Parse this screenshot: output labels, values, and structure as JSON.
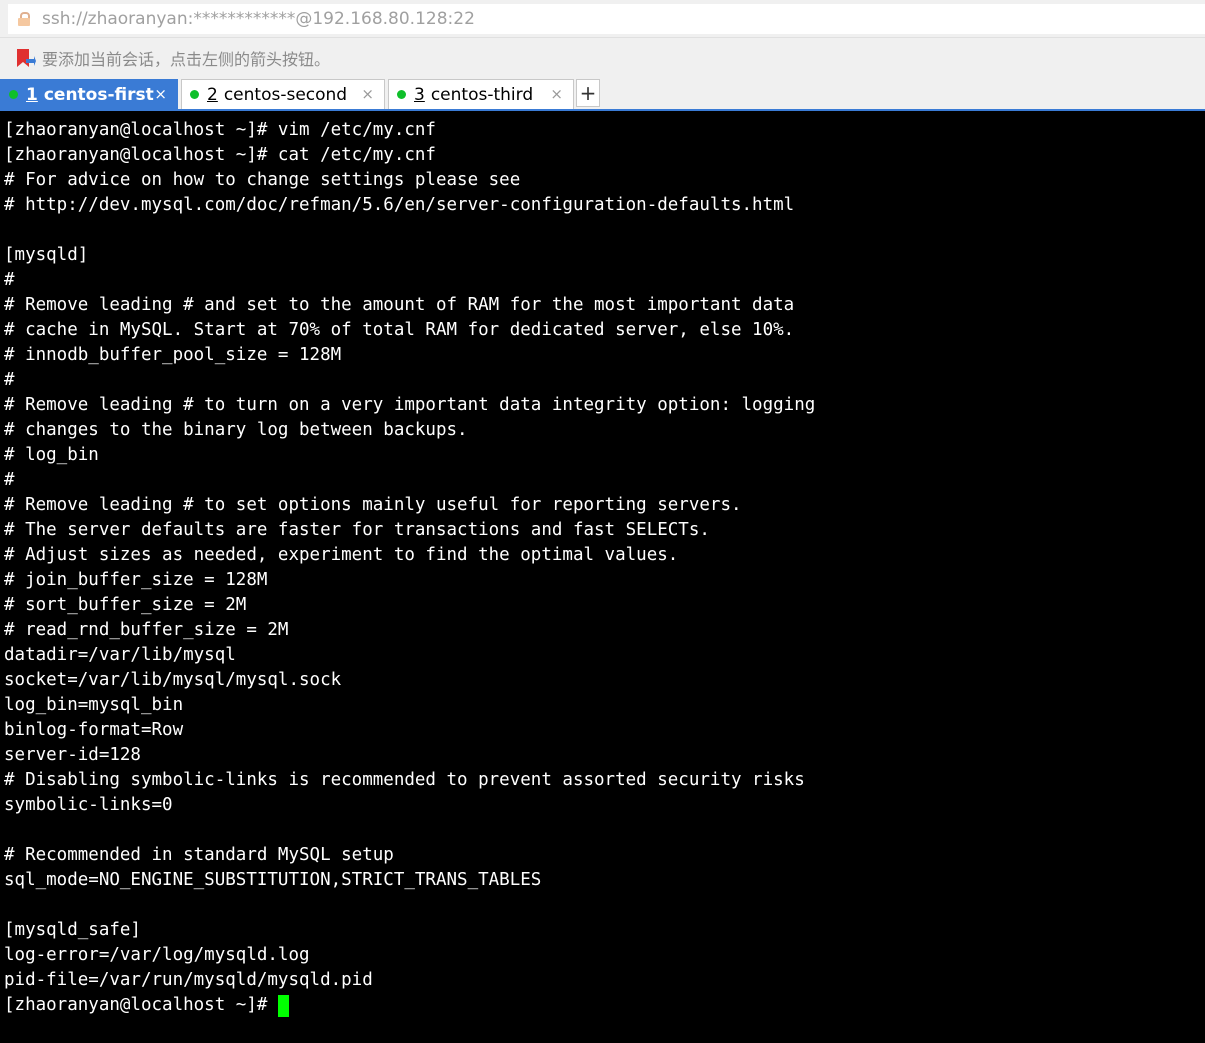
{
  "address_bar": {
    "url": "ssh://zhaoranyan:************@192.168.80.128:22",
    "icon": "lock-icon"
  },
  "hint_bar": {
    "text": "要添加当前会话，点击左侧的箭头按钮。",
    "icon": "bookmark-arrow-icon"
  },
  "tabs": [
    {
      "number": "1",
      "label": "centos-first",
      "active": true,
      "status_color": "#0fbf2a"
    },
    {
      "number": "2",
      "label": "centos-second",
      "active": false,
      "status_color": "#0fbf2a"
    },
    {
      "number": "3",
      "label": "centos-third",
      "active": false,
      "status_color": "#0fbf2a"
    }
  ],
  "tab_close_glyph": "×",
  "tab_add_glyph": "+",
  "terminal": {
    "lines": [
      "[zhaoranyan@localhost ~]# vim /etc/my.cnf",
      "[zhaoranyan@localhost ~]# cat /etc/my.cnf",
      "# For advice on how to change settings please see",
      "# http://dev.mysql.com/doc/refman/5.6/en/server-configuration-defaults.html",
      "",
      "[mysqld]",
      "#",
      "# Remove leading # and set to the amount of RAM for the most important data",
      "# cache in MySQL. Start at 70% of total RAM for dedicated server, else 10%.",
      "# innodb_buffer_pool_size = 128M",
      "#",
      "# Remove leading # to turn on a very important data integrity option: logging",
      "# changes to the binary log between backups.",
      "# log_bin",
      "#",
      "# Remove leading # to set options mainly useful for reporting servers.",
      "# The server defaults are faster for transactions and fast SELECTs.",
      "# Adjust sizes as needed, experiment to find the optimal values.",
      "# join_buffer_size = 128M",
      "# sort_buffer_size = 2M",
      "# read_rnd_buffer_size = 2M",
      "datadir=/var/lib/mysql",
      "socket=/var/lib/mysql/mysql.sock",
      "log_bin=mysql_bin",
      "binlog-format=Row",
      "server-id=128",
      "# Disabling symbolic-links is recommended to prevent assorted security risks",
      "symbolic-links=0",
      "",
      "# Recommended in standard MySQL setup",
      "sql_mode=NO_ENGINE_SUBSTITUTION,STRICT_TRANS_TABLES",
      "",
      "[mysqld_safe]",
      "log-error=/var/log/mysqld.log",
      "pid-file=/var/run/mysqld/mysqld.pid",
      "[zhaoranyan@localhost ~]# "
    ],
    "cursor_color": "#00ff00"
  }
}
